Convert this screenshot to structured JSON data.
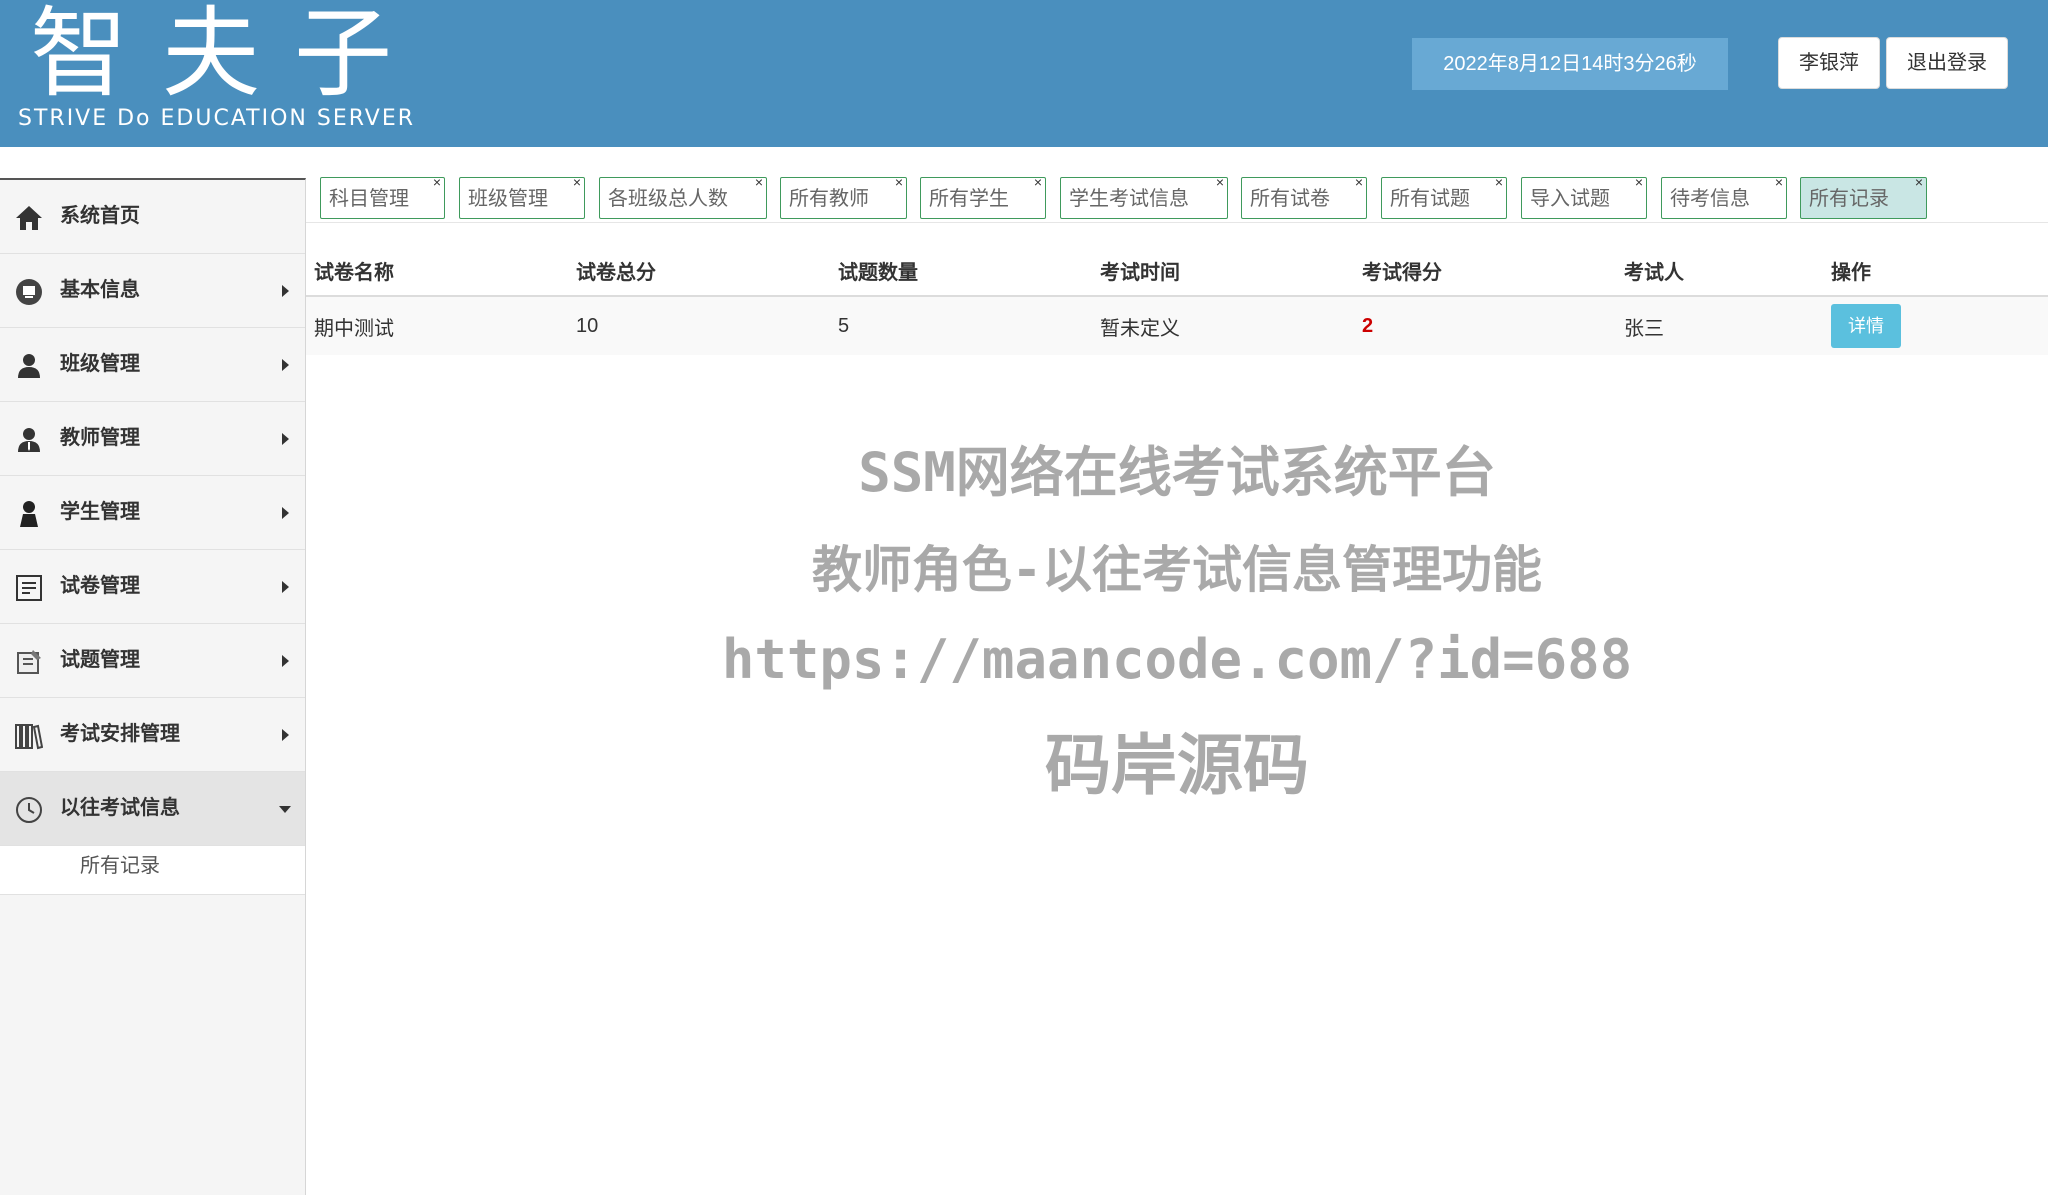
{
  "header": {
    "logo_main": "智夫子",
    "logo_sub": "STRIVE Do EDUCATION SERVER",
    "datetime": "2022年8月12日14时3分26秒",
    "user_label": "李银萍",
    "logout_label": "退出登录",
    "bg_color": "#4a8fbe"
  },
  "sidebar": {
    "items": [
      {
        "label": "系统首页",
        "icon": "home-icon"
      },
      {
        "label": "基本信息",
        "icon": "monitor-icon"
      },
      {
        "label": "班级管理",
        "icon": "users-icon"
      },
      {
        "label": "教师管理",
        "icon": "teacher-icon"
      },
      {
        "label": "学生管理",
        "icon": "student-icon"
      },
      {
        "label": "试卷管理",
        "icon": "paper-icon"
      },
      {
        "label": "试题管理",
        "icon": "question-icon"
      },
      {
        "label": "考试安排管理",
        "icon": "books-icon"
      },
      {
        "label": "以往考试信息",
        "icon": "clock-icon"
      }
    ],
    "sub_items": [
      {
        "label": "所有记录"
      }
    ]
  },
  "tabs": [
    {
      "label": "科目管理"
    },
    {
      "label": "班级管理"
    },
    {
      "label": "各班级总人数"
    },
    {
      "label": "所有教师"
    },
    {
      "label": "所有学生"
    },
    {
      "label": "学生考试信息"
    },
    {
      "label": "所有试卷"
    },
    {
      "label": "所有试题"
    },
    {
      "label": "导入试题"
    },
    {
      "label": "待考信息"
    },
    {
      "label": "所有记录"
    }
  ],
  "tab_close_symbol": "×",
  "table": {
    "headers": [
      "试卷名称",
      "试卷总分",
      "试题数量",
      "考试时间",
      "考试得分",
      "考试人",
      "操作"
    ],
    "rows": [
      {
        "name": "期中测试",
        "total": "10",
        "count": "5",
        "time": "暂未定义",
        "score": "2",
        "examinee": "张三",
        "action": "详情"
      }
    ]
  },
  "watermark": {
    "line1": "SSM网络在线考试系统平台",
    "line2": "教师角色-以往考试信息管理功能",
    "line3": "https://maancode.com/?id=688",
    "line4": "码岸源码"
  }
}
